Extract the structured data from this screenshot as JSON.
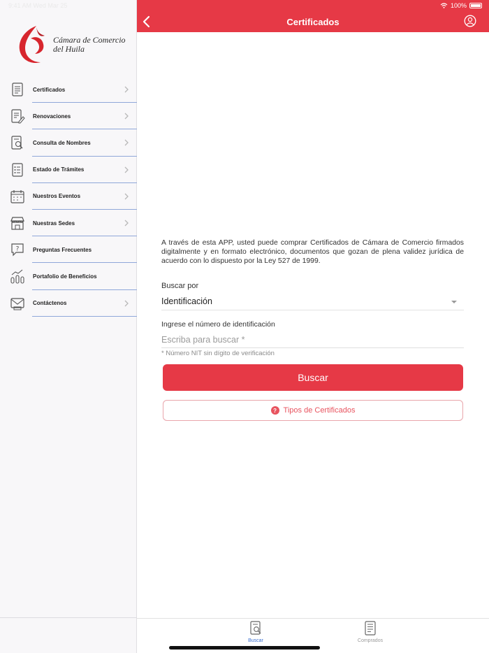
{
  "status_bar": {
    "time": "9:41 AM   Wed Mar 25",
    "battery": "100%"
  },
  "logo": {
    "line1": "Cámara de Comercio",
    "line2": "del Huila"
  },
  "header": {
    "title": "Certificados"
  },
  "sidebar": {
    "items": [
      {
        "label": "Certificados",
        "icon": "document-icon",
        "chevron": true
      },
      {
        "label": "Renovaciones",
        "icon": "document-edit-icon",
        "chevron": true
      },
      {
        "label": "Consulta de Nombres",
        "icon": "document-search-icon",
        "chevron": true
      },
      {
        "label": "Estado de Trámites",
        "icon": "checklist-icon",
        "chevron": true
      },
      {
        "label": "Nuestros Eventos",
        "icon": "calendar-icon",
        "chevron": true
      },
      {
        "label": "Nuestras Sedes",
        "icon": "store-icon",
        "chevron": true
      },
      {
        "label": "Preguntas Frecuentes",
        "icon": "question-chat-icon",
        "chevron": false
      },
      {
        "label": "Portafolio de Beneficios",
        "icon": "growth-chart-icon",
        "chevron": false
      },
      {
        "label": "Contáctenos",
        "icon": "mail-icon",
        "chevron": true
      }
    ]
  },
  "main": {
    "intro": "A través de esta APP, usted puede comprar Certificados de Cámara de Comercio firmados digitalmente y en formato electrónico, documentos que gozan de plena validez jurídica de acuerdo con lo dispuesto por la Ley 527 de 1999.",
    "search_by_label": "Buscar por",
    "search_by_value": "Identificación",
    "id_label": "Ingrese el número de identificación",
    "id_placeholder": "Escriba para buscar *",
    "hint": "* Número NIT sin dígito de verificación",
    "search_button": "Buscar",
    "types_button": "Tipos de Certificados"
  },
  "tabbar": {
    "tabs": [
      {
        "label": "Buscar",
        "active": true
      },
      {
        "label": "Comprados",
        "active": false
      }
    ]
  },
  "colors": {
    "brand_red": "#e63946",
    "tab_active": "#3a6fd0",
    "divider": "#8fa7d9"
  }
}
